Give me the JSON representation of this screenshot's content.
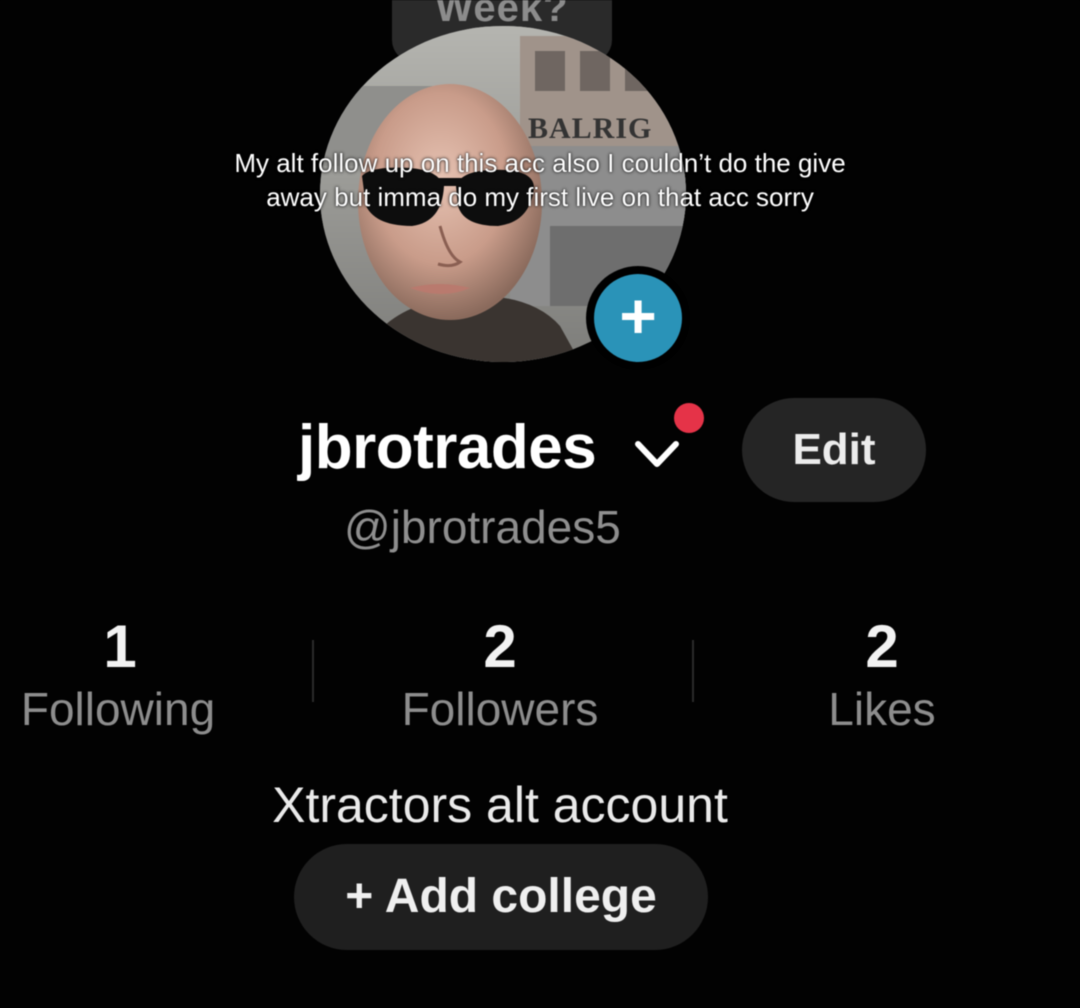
{
  "bubble": {
    "text": "Week?"
  },
  "avatar": {
    "sign_text": "BALRIG",
    "add_symbol": "+"
  },
  "caption": {
    "text": "My alt follow up on this acc also I couldn’t do the give away but imma do my first live on that acc sorry"
  },
  "profile": {
    "username": "jbrotrades",
    "handle": "@jbrotrades5",
    "edit_label": "Edit",
    "bio": "Xtractors alt account",
    "add_college_label": "+ Add college"
  },
  "stats": [
    {
      "value": "1",
      "label": "Following"
    },
    {
      "value": "2",
      "label": "Followers"
    },
    {
      "value": "2",
      "label": "Likes"
    }
  ],
  "colors": {
    "background": "#000000",
    "accent_blue": "#2a93b8",
    "notification_red": "#e53348",
    "pill_bg": "#252525",
    "muted_text": "#8d8d8d"
  },
  "icons": [
    "chevron-down-icon",
    "plus-icon",
    "notification-dot"
  ]
}
